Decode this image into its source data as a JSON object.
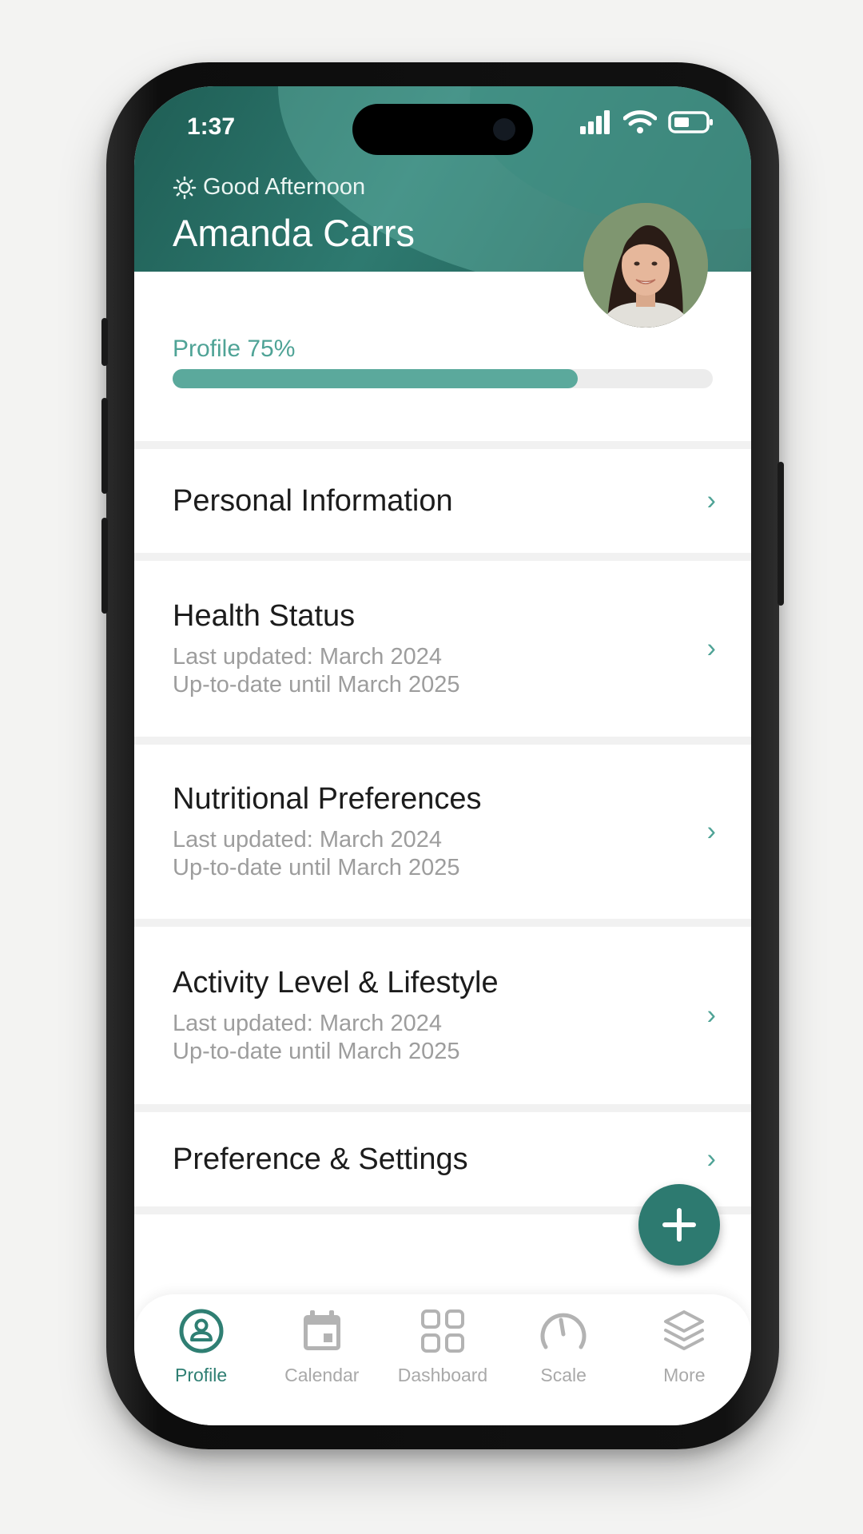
{
  "status_bar": {
    "time": "1:37"
  },
  "header": {
    "greeting": "Good Afternoon",
    "user_name": "Amanda Carrs"
  },
  "profile_progress": {
    "label": "Profile 75%",
    "value": 0.75
  },
  "menu": {
    "items": [
      {
        "title": "Personal Information"
      },
      {
        "title": "Health Status",
        "line1": "Last updated: March 2024",
        "line2": "Up-to-date until March 2025"
      },
      {
        "title": "Nutritional Preferences",
        "line1": "Last updated: March 2024",
        "line2": "Up-to-date until March 2025"
      },
      {
        "title": "Activity Level & Lifestyle",
        "line1": "Last updated: March 2024",
        "line2": "Up-to-date until March 2025"
      },
      {
        "title": "Preference & Settings"
      }
    ]
  },
  "tabbar": {
    "tabs": [
      {
        "label": "Profile",
        "icon": "profile-icon",
        "active": true
      },
      {
        "label": "Calendar",
        "icon": "calendar-icon",
        "active": false
      },
      {
        "label": "Dashboard",
        "icon": "dashboard-icon",
        "active": false
      },
      {
        "label": "Scale",
        "icon": "scale-icon",
        "active": false
      },
      {
        "label": "More",
        "icon": "layers-icon",
        "active": false
      }
    ]
  },
  "colors": {
    "accent": "#2f7f73",
    "progress": "#5ba99c",
    "header": "#26695f"
  }
}
